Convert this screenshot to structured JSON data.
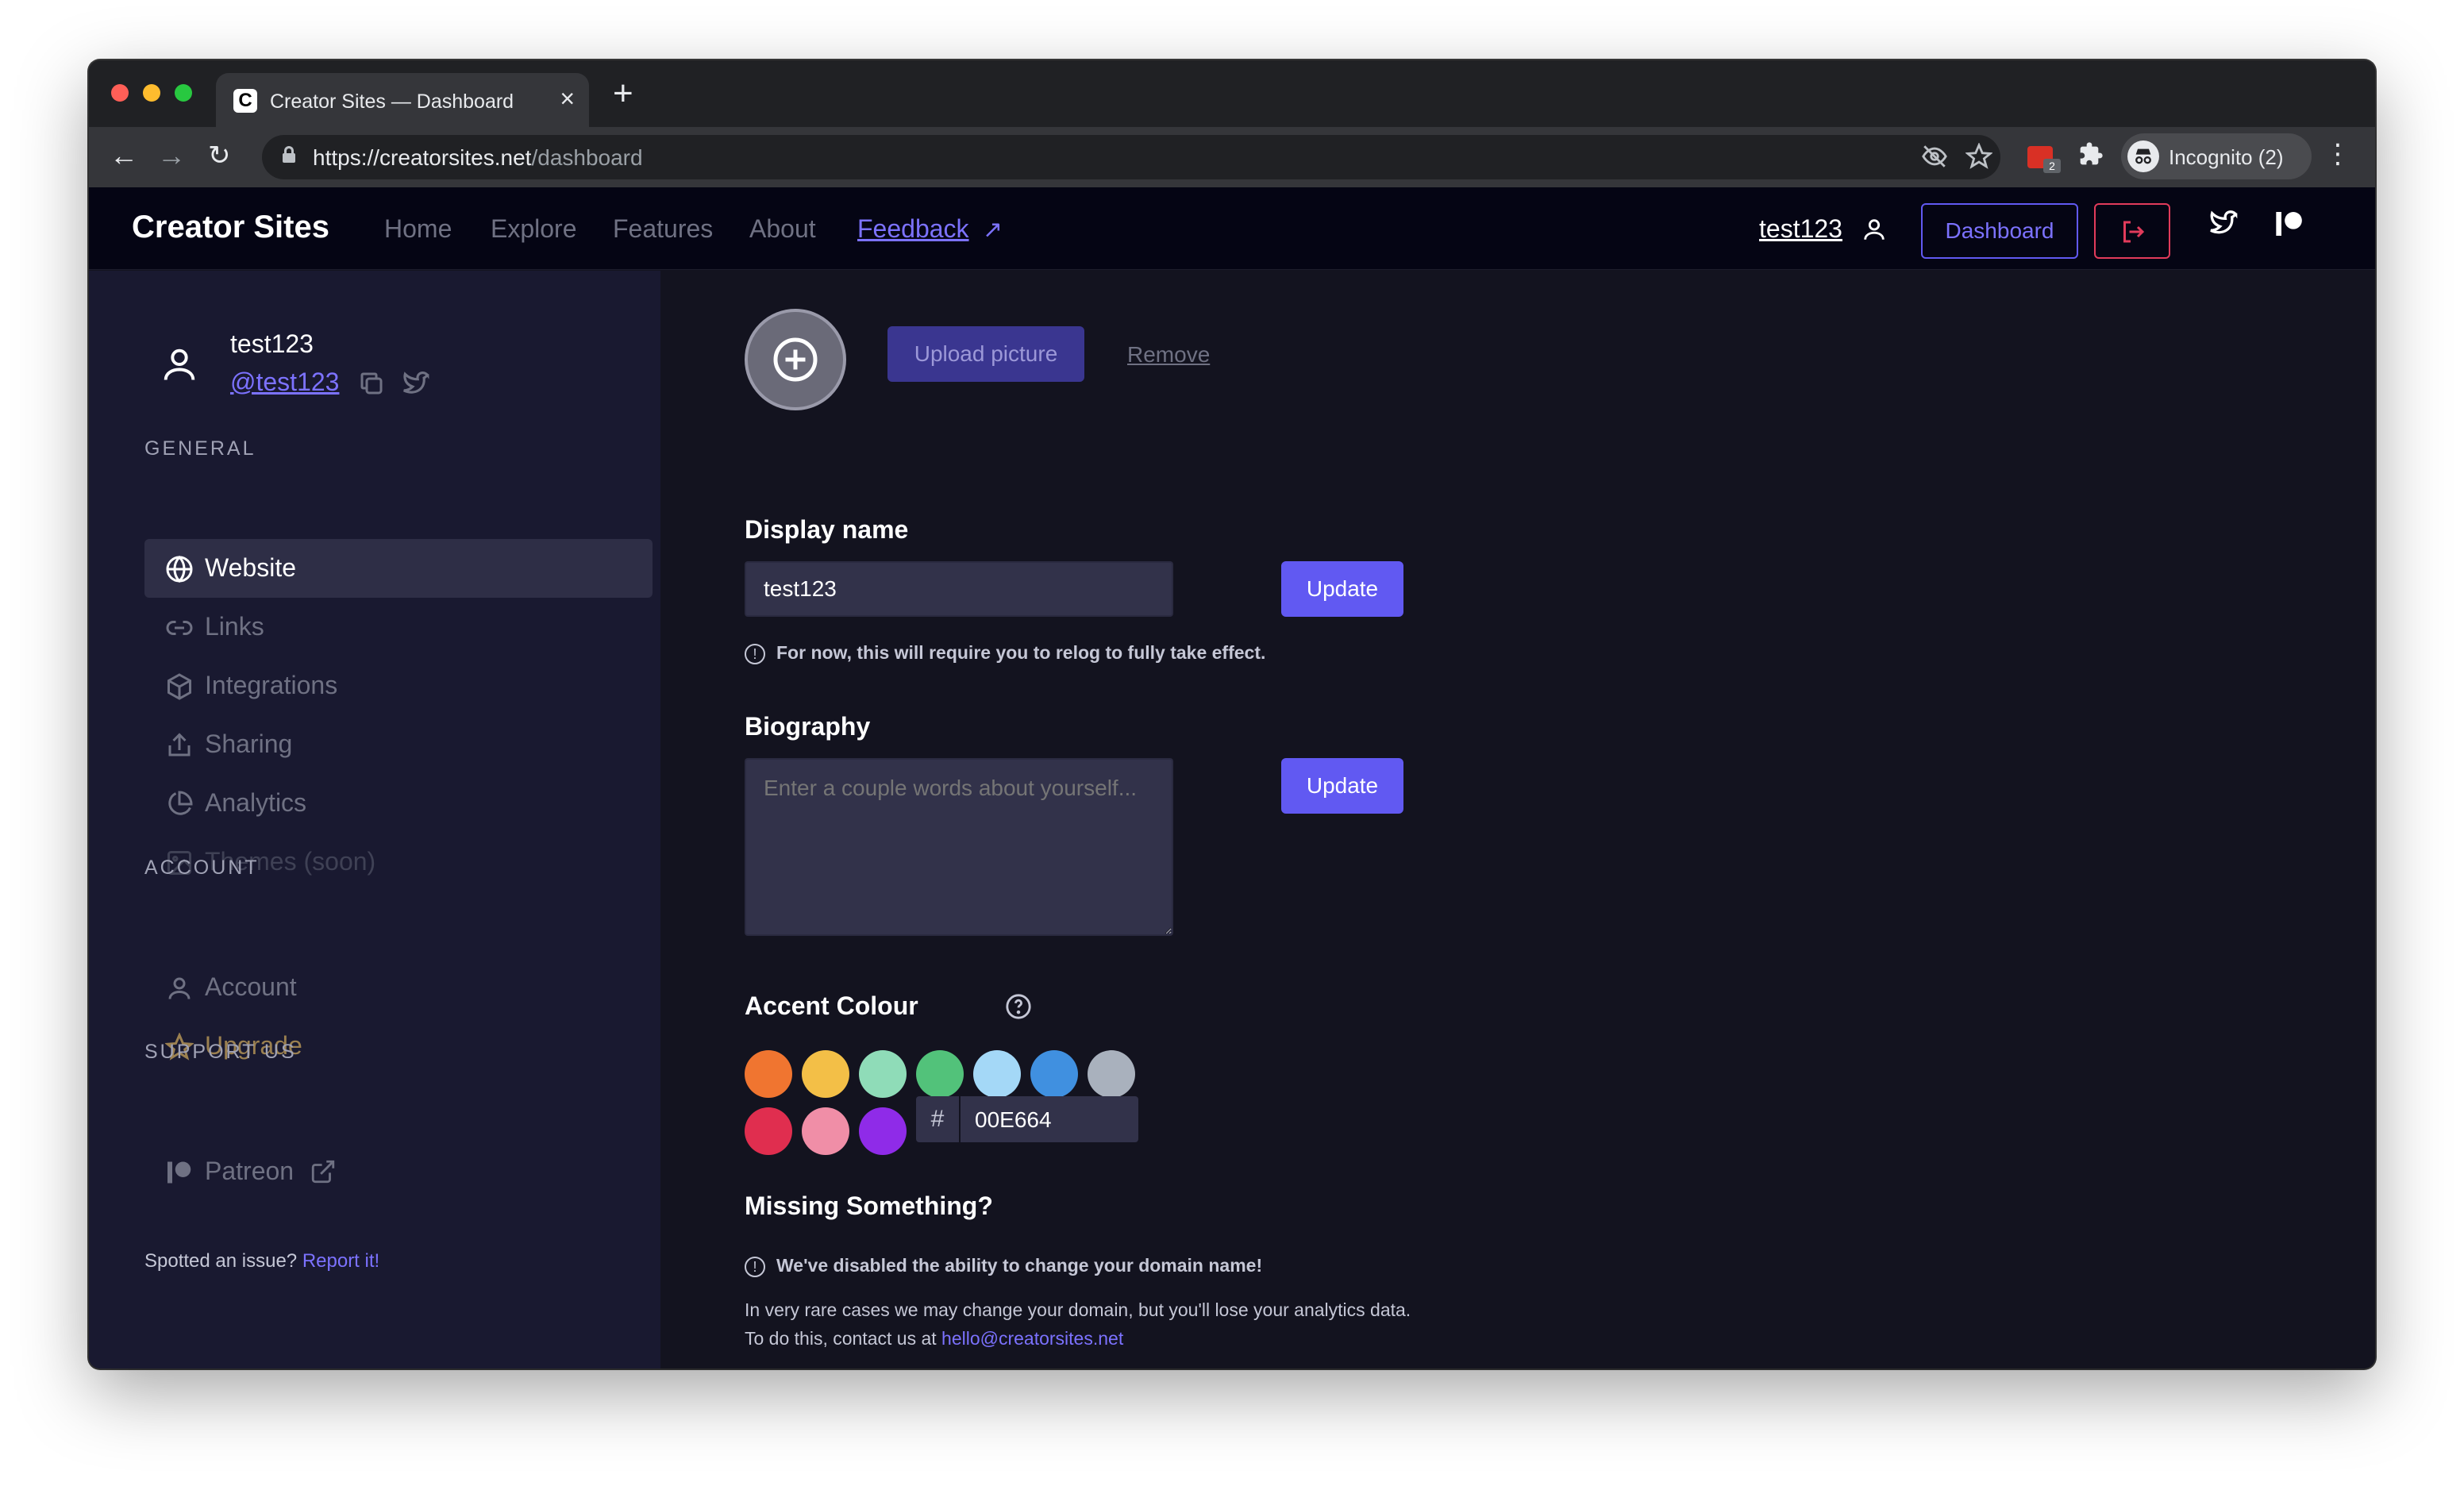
{
  "browser": {
    "tab_title": "Creator Sites — Dashboard",
    "favicon_letter": "C",
    "url_host": "https://creatorsites.net",
    "url_path": "/dashboard",
    "incognito_label": "Incognito (2)",
    "extension_badge": "2"
  },
  "header": {
    "brand": "Creator Sites",
    "nav": [
      "Home",
      "Explore",
      "Features",
      "About",
      "Feedback"
    ],
    "username": "test123",
    "dashboard_label": "Dashboard"
  },
  "sidebar": {
    "profile_name": "test123",
    "profile_handle": "@test123",
    "sections": {
      "general": "GENERAL",
      "account": "ACCOUNT",
      "support": "SUPPORT US"
    },
    "items": {
      "website": "Website",
      "links": "Links",
      "integrations": "Integrations",
      "sharing": "Sharing",
      "analytics": "Analytics",
      "themes": "Themes (soon)",
      "account": "Account",
      "upgrade": "Upgrade",
      "patreon": "Patreon"
    },
    "spotted_text": "Spotted an issue?",
    "report_link": "Report it!"
  },
  "main": {
    "upload_label": "Upload picture",
    "remove_label": "Remove",
    "display_name": {
      "label": "Display name",
      "value": "test123",
      "button": "Update",
      "hint": "For now, this will require you to relog to fully take effect."
    },
    "biography": {
      "label": "Biography",
      "placeholder": "Enter a couple words about yourself...",
      "button": "Update"
    },
    "accent": {
      "label": "Accent Colour",
      "swatches": [
        "#f07530",
        "#f3bf47",
        "#8fdcb8",
        "#52c27a",
        "#a4d8f7",
        "#4090e0",
        "#a9b1bd",
        "#e02e4f",
        "#f08ea7",
        "#8f2be8"
      ],
      "hash": "#",
      "hex_value": "00E664"
    },
    "missing": {
      "label": "Missing Something?",
      "warning": "We've disabled the ability to change your domain name!",
      "line1": "In very rare cases we may change your domain, but you'll lose your analytics data.",
      "line2_prefix": "To do this, contact us at",
      "email": "hello@creatorsites.net"
    }
  }
}
